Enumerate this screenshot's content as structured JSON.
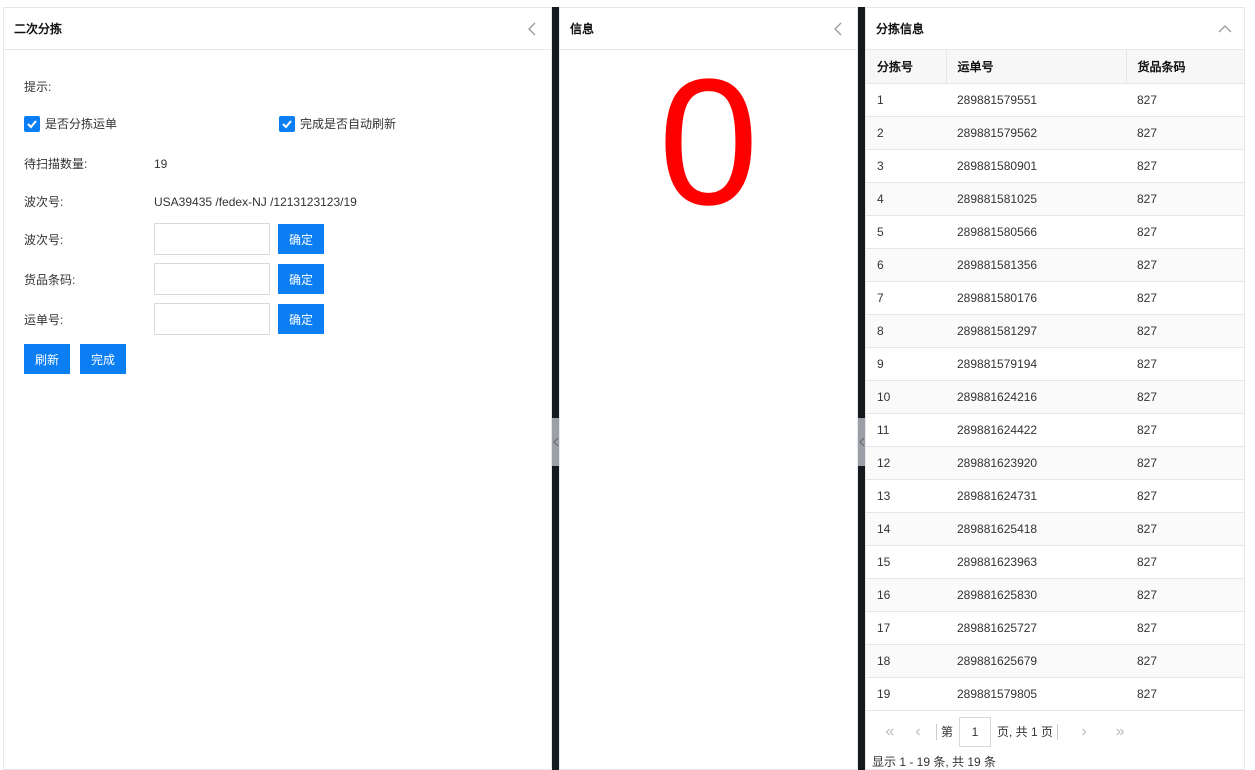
{
  "left_panel": {
    "title": "二次分拣",
    "hint_label": "提示:",
    "checkbox_split": "是否分拣运单",
    "checkbox_auto_refresh": "完成是否自动刷新",
    "pending_label": "待扫描数量:",
    "pending_value": "19",
    "batch_label": "波次号:",
    "batch_value": "USA39435 /fedex-NJ /1213123123/19",
    "batch_input_label": "波次号:",
    "barcode_input_label": "货品条码:",
    "waybill_input_label": "运单号:",
    "confirm_label": "确定",
    "refresh_label": "刷新",
    "finish_label": "完成"
  },
  "middle_panel": {
    "title": "信息",
    "big_number": "0"
  },
  "right_panel": {
    "title": "分拣信息",
    "columns": [
      "分拣号",
      "运单号",
      "货品条码"
    ],
    "rows": [
      [
        "1",
        "289881579551",
        "827"
      ],
      [
        "2",
        "289881579562",
        "827"
      ],
      [
        "3",
        "289881580901",
        "827"
      ],
      [
        "4",
        "289881581025",
        "827"
      ],
      [
        "5",
        "289881580566",
        "827"
      ],
      [
        "6",
        "289881581356",
        "827"
      ],
      [
        "7",
        "289881580176",
        "827"
      ],
      [
        "8",
        "289881581297",
        "827"
      ],
      [
        "9",
        "289881579194",
        "827"
      ],
      [
        "10",
        "289881624216",
        "827"
      ],
      [
        "11",
        "289881624422",
        "827"
      ],
      [
        "12",
        "289881623920",
        "827"
      ],
      [
        "13",
        "289881624731",
        "827"
      ],
      [
        "14",
        "289881625418",
        "827"
      ],
      [
        "15",
        "289881623963",
        "827"
      ],
      [
        "16",
        "289881625830",
        "827"
      ],
      [
        "17",
        "289881625727",
        "827"
      ],
      [
        "18",
        "289881625679",
        "827"
      ],
      [
        "19",
        "289881579805",
        "827"
      ]
    ],
    "pager": {
      "page_prefix": "第",
      "current_page": "1",
      "page_suffix": "页, 共 1 页",
      "summary": "显示 1 - 19 条, 共 19 条"
    }
  },
  "colors": {
    "primary": "#0b7ef3",
    "big_number": "#ff0000",
    "splitter": "#14191e"
  },
  "icons": [
    "chevron-left-icon",
    "chevron-up-icon",
    "checkbox-checked-icon",
    "first-page-icon",
    "prev-page-icon",
    "next-page-icon",
    "last-page-icon"
  ]
}
